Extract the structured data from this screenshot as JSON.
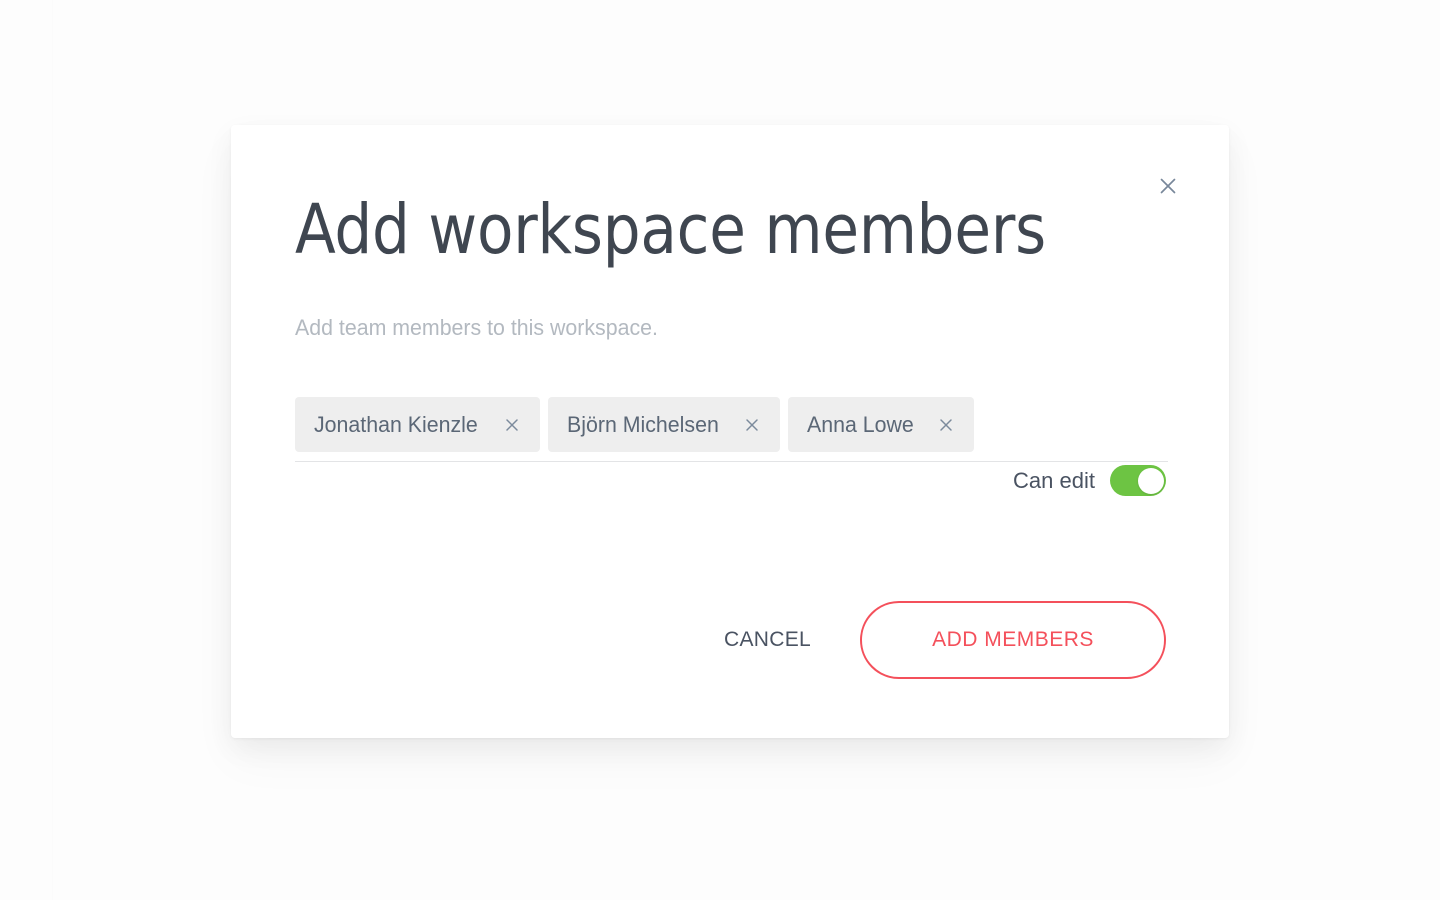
{
  "dialog": {
    "title": "Add workspace members",
    "subtitle": "Add team members to this workspace.",
    "close_icon": "close-icon",
    "close_label": "Close"
  },
  "members_field": {
    "chips": [
      {
        "name": "Jonathan Kienzle",
        "remove_icon": "close-icon"
      },
      {
        "name": "Björn Michelsen",
        "remove_icon": "close-icon"
      },
      {
        "name": "Anna Lowe",
        "remove_icon": "close-icon"
      }
    ]
  },
  "permission": {
    "label": "Can edit",
    "enabled": true,
    "toggle_on_color": "#6dc443",
    "knob_color": "#ffffff"
  },
  "actions": {
    "cancel_label": "CANCEL",
    "submit_label": "ADD MEMBERS",
    "submit_accent_color": "#f4505b"
  },
  "colors": {
    "page_background": "#fdfdfd",
    "modal_background": "#ffffff",
    "title_text": "#3f4650",
    "subtitle_text": "#b3b9c0",
    "chip_background": "#eeeeee",
    "chip_text": "#5b6776",
    "field_underline": "#e3e4e6"
  }
}
